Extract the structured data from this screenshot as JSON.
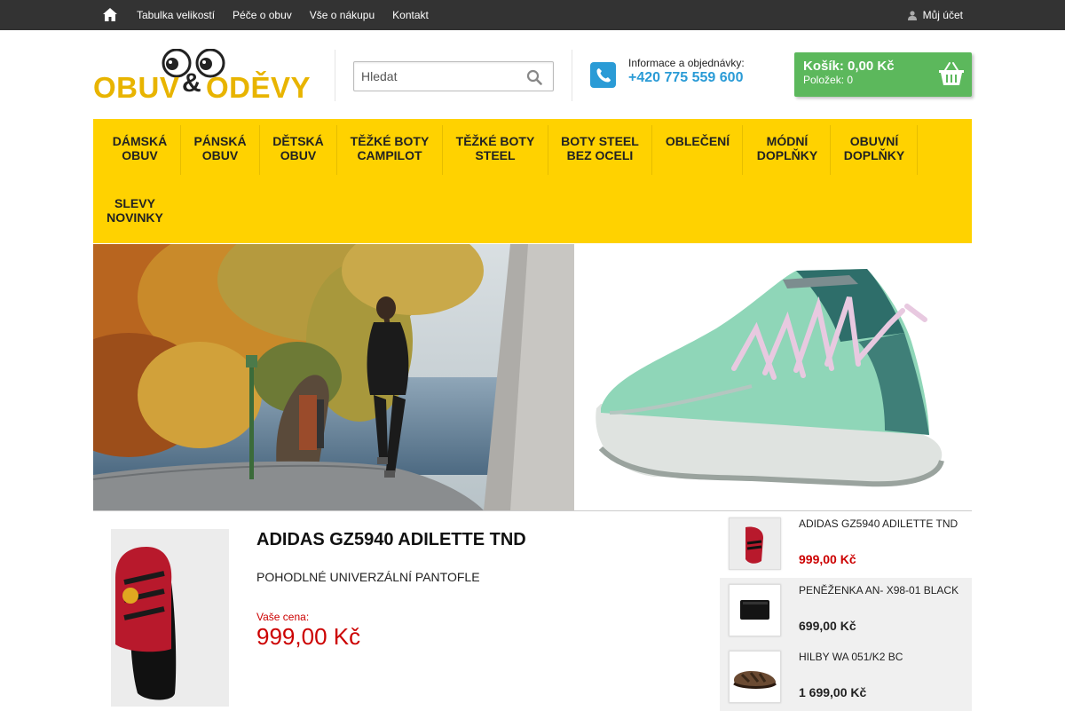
{
  "topbar": {
    "nav": [
      "Tabulka velikostí",
      "Péče o obuv",
      "Vše o nákupu",
      "Kontakt"
    ],
    "account": "Můj účet"
  },
  "logo": {
    "word1": "OBUV",
    "amp": "&",
    "word2": "ODĚVY"
  },
  "search": {
    "placeholder": "Hledat"
  },
  "contact": {
    "label": "Informace a objednávky:",
    "phone": "+420 775 559 600"
  },
  "cart": {
    "title": "Košík: 0,00 Kč",
    "count": "Položek: 0"
  },
  "mainnav": {
    "items": [
      {
        "line1": "DÁMSKÁ",
        "line2": "OBUV"
      },
      {
        "line1": "PÁNSKÁ",
        "line2": "OBUV"
      },
      {
        "line1": "DĚTSKÁ",
        "line2": "OBUV"
      },
      {
        "line1": "TĚŽKÉ BOTY",
        "line2": "CAMPILOT"
      },
      {
        "line1": "TĚŽKÉ BOTY",
        "line2": "STEEL"
      },
      {
        "line1": "BOTY STEEL",
        "line2": "BEZ OCELI"
      },
      {
        "line1": "OBLEČENÍ",
        "line2": ""
      },
      {
        "line1": "MÓDNÍ",
        "line2": "DOPLŇKY"
      },
      {
        "line1": "OBUVNÍ",
        "line2": "DOPLŇKY"
      },
      {
        "line1": "SLEVY",
        "line2": "NOVINKY"
      }
    ]
  },
  "product": {
    "title": "ADIDAS GZ5940 ADILETTE TND",
    "description": "POHODLNÉ UNIVERZÁLNÍ PANTOFLE",
    "price_label": "Vaše cena:",
    "price": "999,00 Kč"
  },
  "side": {
    "items": [
      {
        "name": "ADIDAS GZ5940 ADILETTE TND",
        "price": "999,00 Kč",
        "price_color": "#cc0000"
      },
      {
        "name": "PENĚŽENKA AN- X98-01 BLACK",
        "price": "699,00 Kč",
        "price_color": "#222222"
      },
      {
        "name": "HILBY WA 051/K2 BC",
        "price": "1 699,00 Kč",
        "price_color": "#222222"
      }
    ]
  },
  "colors": {
    "topbar": "#333333",
    "nav": "#ffd200",
    "cart": "#5cb85c",
    "accent": "#2a9bd6",
    "price": "#cc0000"
  }
}
